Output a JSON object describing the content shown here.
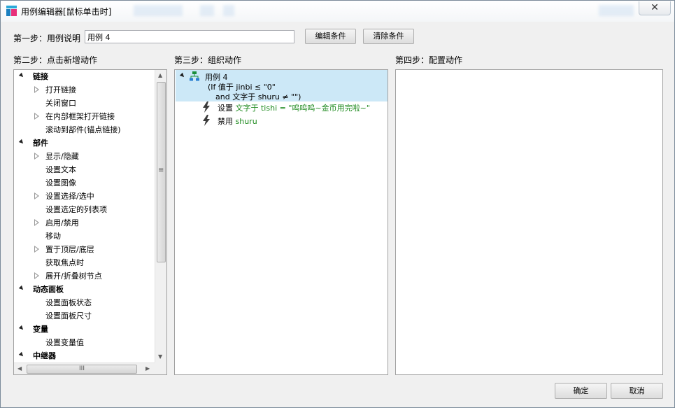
{
  "window": {
    "title": "用例编辑器[鼠标单击时]",
    "close_label": "✕"
  },
  "step1": {
    "label": "第一步：用例说明",
    "case_name_value": "用例 4",
    "edit_condition_label": "编辑条件",
    "clear_condition_label": "清除条件"
  },
  "step2": {
    "label": "第二步：点击新增动作",
    "tree": [
      {
        "text": "链接",
        "type": "category"
      },
      {
        "text": "打开链接",
        "type": "item",
        "expandable": true
      },
      {
        "text": "关闭窗口",
        "type": "item",
        "expandable": false
      },
      {
        "text": "在内部框架打开链接",
        "type": "item",
        "expandable": true
      },
      {
        "text": "滚动到部件(锚点链接)",
        "type": "item",
        "expandable": false
      },
      {
        "text": "部件",
        "type": "category"
      },
      {
        "text": "显示/隐藏",
        "type": "item",
        "expandable": true
      },
      {
        "text": "设置文本",
        "type": "item",
        "expandable": false
      },
      {
        "text": "设置图像",
        "type": "item",
        "expandable": false
      },
      {
        "text": "设置选择/选中",
        "type": "item",
        "expandable": true
      },
      {
        "text": "设置选定的列表项",
        "type": "item",
        "expandable": false
      },
      {
        "text": "启用/禁用",
        "type": "item",
        "expandable": true
      },
      {
        "text": "移动",
        "type": "item",
        "expandable": false
      },
      {
        "text": "置于顶层/底层",
        "type": "item",
        "expandable": true
      },
      {
        "text": "获取焦点时",
        "type": "item",
        "expandable": false
      },
      {
        "text": "展开/折叠树节点",
        "type": "item",
        "expandable": true
      },
      {
        "text": "动态面板",
        "type": "category"
      },
      {
        "text": "设置面板状态",
        "type": "item",
        "expandable": false
      },
      {
        "text": "设置面板尺寸",
        "type": "item",
        "expandable": false
      },
      {
        "text": "变量",
        "type": "category"
      },
      {
        "text": "设置变量值",
        "type": "item",
        "expandable": false
      },
      {
        "text": "中继器",
        "type": "category"
      }
    ],
    "hscroll_grip": "III",
    "vscroll_grip": "≡"
  },
  "step3": {
    "label": "第三步：组织动作",
    "case_title": "用例 4",
    "condition_line1": "(If 值于 jinbi ≤ \"0\"",
    "condition_line2": "and 文字于 shuru ≠ \"\")",
    "actions": [
      {
        "verb": "设置",
        "detail": "文字于 tishi = \"呜呜呜~金币用完啦~\""
      },
      {
        "verb": "禁用",
        "detail": "shuru"
      }
    ]
  },
  "step4": {
    "label": "第四步：配置动作"
  },
  "footer": {
    "ok_label": "确定",
    "cancel_label": "取消"
  },
  "colors": {
    "selection": "#cce8f7",
    "action_detail": "#1e8a1e"
  }
}
